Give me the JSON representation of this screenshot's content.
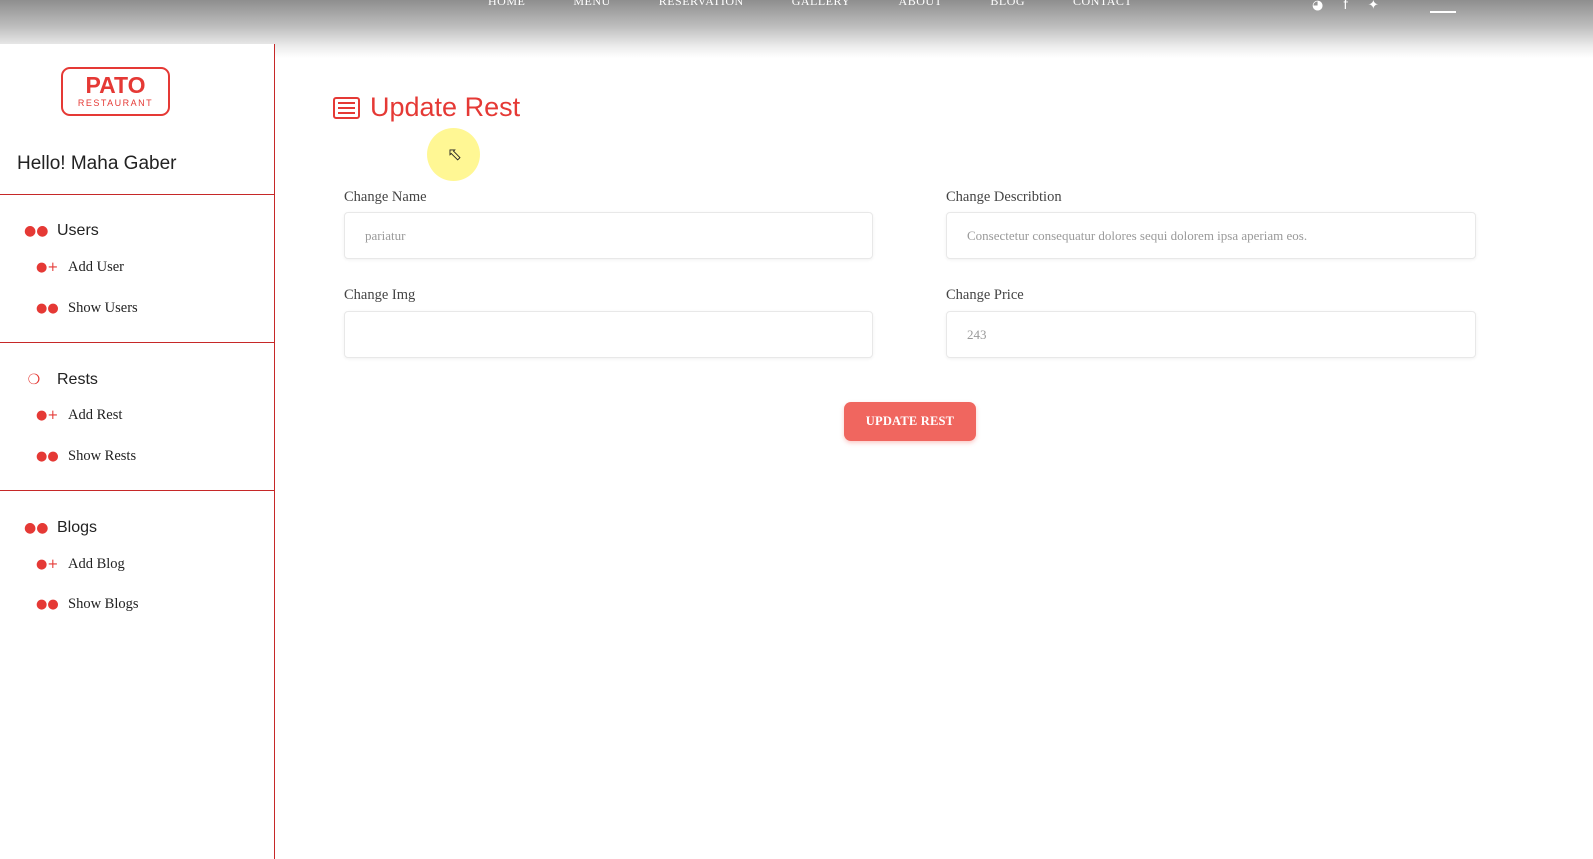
{
  "topnav": {
    "items": [
      "HOME",
      "MENU",
      "RESERVATION",
      "GALLERY",
      "ABOUT",
      "BLOG",
      "CONTACT"
    ],
    "icons": [
      "tripadvisor-icon",
      "facebook-icon",
      "twitter-icon",
      "hamburger-menu-icon"
    ]
  },
  "sidebar": {
    "logo": {
      "line1": "PATO",
      "line2": "RESTAURANT"
    },
    "greeting": "Hello! Maha Gaber",
    "sections": [
      {
        "title": "Users",
        "icon": "users-icon",
        "items": [
          {
            "label": "Add User",
            "icon": "user-plus-icon"
          },
          {
            "label": "Show Users",
            "icon": "users-icon"
          }
        ]
      },
      {
        "title": "Rests",
        "icon": "restaurant-icon",
        "items": [
          {
            "label": "Add Rest",
            "icon": "user-plus-icon"
          },
          {
            "label": "Show Rests",
            "icon": "users-icon"
          }
        ]
      },
      {
        "title": "Blogs",
        "icon": "users-icon",
        "items": [
          {
            "label": "Add Blog",
            "icon": "user-plus-icon"
          },
          {
            "label": "Show Blogs",
            "icon": "users-icon"
          }
        ]
      }
    ]
  },
  "main": {
    "title": "Update Rest",
    "title_icon": "list-alt-icon",
    "fields": {
      "name": {
        "label": "Change Name",
        "value": "pariatur"
      },
      "description": {
        "label": "Change Describtion",
        "value": "Consectetur consequatur dolores sequi dolorem ipsa aperiam eos."
      },
      "img": {
        "label": "Change Img",
        "value": ""
      },
      "price": {
        "label": "Change Price",
        "value": "243"
      }
    },
    "submit_label": "UPDATE REST"
  },
  "colors": {
    "accent": "#e53935",
    "button": "#f0665f",
    "divider": "#c62828"
  }
}
